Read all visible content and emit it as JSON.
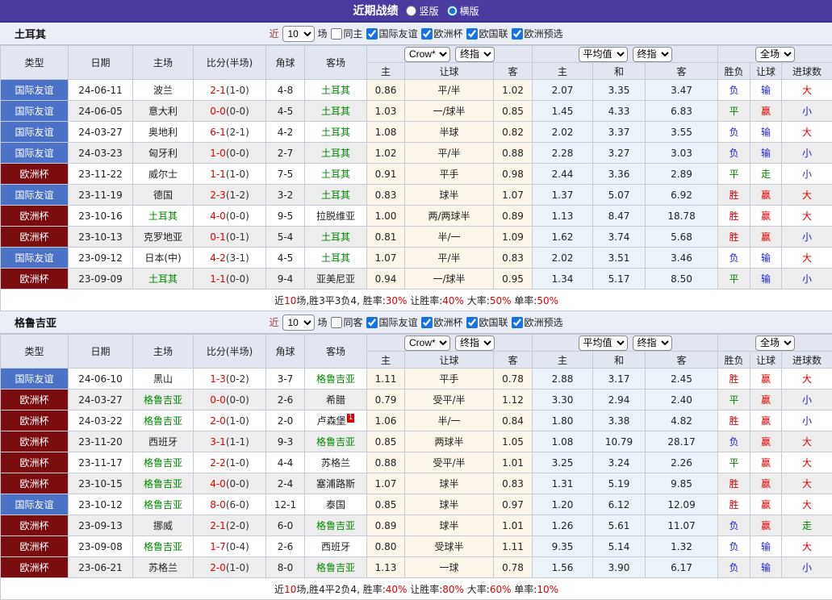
{
  "colors": {
    "header_bar": "#4b3b9e",
    "friendly_badge": "#4a73c8",
    "cup_badge": "#7b0c10",
    "focus_team_green": "#008800",
    "win_red": "#e10000",
    "loss_blue": "#2222cc",
    "draw_green": "#008000",
    "odds_col_bg": "#fcf5ea",
    "avg_col_bg": "#eaf3fa"
  },
  "titlebar": {
    "title": "近期战绩",
    "view_options": [
      {
        "label": "竖版",
        "selected": false
      },
      {
        "label": "横版",
        "selected": true
      }
    ]
  },
  "filter": {
    "near_label": "近",
    "games_value": "10",
    "games_suffix": "场",
    "leagues": [
      {
        "label": "国际友谊",
        "checked": true
      },
      {
        "label": "欧洲杯",
        "checked": true
      },
      {
        "label": "欧国联",
        "checked": true
      },
      {
        "label": "欧洲预选",
        "checked": true
      }
    ]
  },
  "table_header": {
    "main_cols": [
      "类型",
      "日期",
      "主场",
      "比分(半场)",
      "角球",
      "客场"
    ],
    "sub_cols": [
      "主",
      "让球",
      "客",
      "主",
      "和",
      "客",
      "胜负",
      "让球",
      "进球数"
    ],
    "selects": {
      "bookmaker": "Crow*",
      "period1": "终指",
      "average": "平均值",
      "period2": "终指",
      "scope": "全场"
    }
  },
  "sections": [
    {
      "team": "土耳其",
      "same_venue_label": "同主",
      "same_venue_checked": false,
      "rows": [
        {
          "type": "国际友谊",
          "badge": "friendly",
          "date": "24-06-11",
          "home": "波兰",
          "home_focus": false,
          "score": "2-1",
          "half": "(1-0)",
          "corner": "4-8",
          "away": "土耳其",
          "away_focus": true,
          "h_odds": "0.86",
          "line": "平/半",
          "a_odds": "1.02",
          "avg_h": "2.07",
          "avg_d": "3.35",
          "avg_a": "3.47",
          "res": "负",
          "res_line": "输",
          "res_goal": "大"
        },
        {
          "type": "国际友谊",
          "badge": "friendly",
          "date": "24-06-05",
          "home": "意大利",
          "home_focus": false,
          "score": "0-0",
          "half": "(0-0)",
          "corner": "4-5",
          "away": "土耳其",
          "away_focus": true,
          "h_odds": "1.03",
          "line": "一/球半",
          "a_odds": "0.85",
          "avg_h": "1.45",
          "avg_d": "4.33",
          "avg_a": "6.83",
          "res": "平",
          "res_line": "赢",
          "res_goal": "小"
        },
        {
          "type": "国际友谊",
          "badge": "friendly",
          "date": "24-03-27",
          "home": "奥地利",
          "home_focus": false,
          "score": "6-1",
          "half": "(2-1)",
          "corner": "4-2",
          "away": "土耳其",
          "away_focus": true,
          "h_odds": "1.08",
          "line": "半球",
          "a_odds": "0.82",
          "avg_h": "2.02",
          "avg_d": "3.37",
          "avg_a": "3.55",
          "res": "负",
          "res_line": "输",
          "res_goal": "大"
        },
        {
          "type": "国际友谊",
          "badge": "friendly",
          "date": "24-03-23",
          "home": "匈牙利",
          "home_focus": false,
          "score": "1-0",
          "half": "(0-0)",
          "corner": "2-7",
          "away": "土耳其",
          "away_focus": true,
          "h_odds": "1.02",
          "line": "平/半",
          "a_odds": "0.88",
          "avg_h": "2.28",
          "avg_d": "3.27",
          "avg_a": "3.03",
          "res": "负",
          "res_line": "输",
          "res_goal": "小"
        },
        {
          "type": "欧洲杯",
          "badge": "cup",
          "date": "23-11-22",
          "home": "威尔士",
          "home_focus": false,
          "score": "1-1",
          "half": "(1-0)",
          "corner": "7-5",
          "away": "土耳其",
          "away_focus": true,
          "h_odds": "0.91",
          "line": "平手",
          "a_odds": "0.98",
          "avg_h": "2.44",
          "avg_d": "3.36",
          "avg_a": "2.89",
          "res": "平",
          "res_line": "走",
          "res_goal": "小"
        },
        {
          "type": "国际友谊",
          "badge": "friendly",
          "date": "23-11-19",
          "home": "德国",
          "home_focus": false,
          "score": "2-3",
          "half": "(1-2)",
          "corner": "3-2",
          "away": "土耳其",
          "away_focus": true,
          "h_odds": "0.83",
          "line": "球半",
          "a_odds": "1.07",
          "avg_h": "1.37",
          "avg_d": "5.07",
          "avg_a": "6.92",
          "res": "胜",
          "res_line": "赢",
          "res_goal": "大"
        },
        {
          "type": "欧洲杯",
          "badge": "cup",
          "date": "23-10-16",
          "home": "土耳其",
          "home_focus": true,
          "score": "4-0",
          "half": "(0-0)",
          "corner": "9-5",
          "away": "拉脱维亚",
          "away_focus": false,
          "h_odds": "1.00",
          "line": "两/两球半",
          "a_odds": "0.89",
          "avg_h": "1.13",
          "avg_d": "8.47",
          "avg_a": "18.78",
          "res": "胜",
          "res_line": "赢",
          "res_goal": "大"
        },
        {
          "type": "欧洲杯",
          "badge": "cup",
          "date": "23-10-13",
          "home": "克罗地亚",
          "home_focus": false,
          "score": "0-1",
          "half": "(0-1)",
          "corner": "5-4",
          "away": "土耳其",
          "away_focus": true,
          "h_odds": "0.81",
          "line": "半/一",
          "a_odds": "1.09",
          "avg_h": "1.62",
          "avg_d": "3.74",
          "avg_a": "5.68",
          "res": "胜",
          "res_line": "赢",
          "res_goal": "小"
        },
        {
          "type": "国际友谊",
          "badge": "friendly",
          "date": "23-09-12",
          "home": "日本(中)",
          "home_focus": false,
          "score": "4-2",
          "half": "(3-1)",
          "corner": "4-5",
          "away": "土耳其",
          "away_focus": true,
          "h_odds": "1.07",
          "line": "平/半",
          "a_odds": "0.83",
          "avg_h": "2.02",
          "avg_d": "3.51",
          "avg_a": "3.46",
          "res": "负",
          "res_line": "输",
          "res_goal": "大"
        },
        {
          "type": "欧洲杯",
          "badge": "cup",
          "date": "23-09-09",
          "home": "土耳其",
          "home_focus": true,
          "score": "1-1",
          "half": "(0-0)",
          "corner": "9-4",
          "away": "亚美尼亚",
          "away_focus": false,
          "h_odds": "0.94",
          "line": "一/球半",
          "a_odds": "0.95",
          "avg_h": "1.34",
          "avg_d": "5.17",
          "avg_a": "8.50",
          "res": "平",
          "res_line": "输",
          "res_goal": "小"
        }
      ],
      "summary_parts": [
        {
          "text": "近",
          "red": false
        },
        {
          "text": "10",
          "red": true
        },
        {
          "text": "场,胜3平3负4, 胜率:",
          "red": false
        },
        {
          "text": "30%",
          "red": true
        },
        {
          "text": " 让胜率:",
          "red": false
        },
        {
          "text": "40%",
          "red": true
        },
        {
          "text": " 大率:",
          "red": false
        },
        {
          "text": "50%",
          "red": true
        },
        {
          "text": " 单率:",
          "red": false
        },
        {
          "text": "50%",
          "red": true
        }
      ]
    },
    {
      "team": "格鲁吉亚",
      "same_venue_label": "同客",
      "same_venue_checked": false,
      "rows": [
        {
          "type": "国际友谊",
          "badge": "friendly",
          "date": "24-06-10",
          "home": "黑山",
          "home_focus": false,
          "score": "1-3",
          "half": "(0-2)",
          "corner": "3-7",
          "away": "格鲁吉亚",
          "away_focus": true,
          "h_odds": "1.11",
          "line": "平手",
          "a_odds": "0.78",
          "avg_h": "2.88",
          "avg_d": "3.17",
          "avg_a": "2.45",
          "res": "胜",
          "res_line": "赢",
          "res_goal": "大"
        },
        {
          "type": "欧洲杯",
          "badge": "cup",
          "date": "24-03-27",
          "home": "格鲁吉亚",
          "home_focus": true,
          "score": "0-0",
          "half": "(0-0)",
          "corner": "2-6",
          "away": "希腊",
          "away_focus": false,
          "h_odds": "0.79",
          "line": "受平/半",
          "a_odds": "1.12",
          "avg_h": "3.30",
          "avg_d": "2.94",
          "avg_a": "2.40",
          "res": "平",
          "res_line": "赢",
          "res_goal": "小"
        },
        {
          "type": "欧洲杯",
          "badge": "cup",
          "date": "24-03-22",
          "home": "格鲁吉亚",
          "home_focus": true,
          "score": "2-0",
          "half": "(1-0)",
          "corner": "2-0",
          "away": "卢森堡",
          "away_focus": false,
          "away_card": "1",
          "h_odds": "1.06",
          "line": "半/一",
          "a_odds": "0.84",
          "avg_h": "1.80",
          "avg_d": "3.38",
          "avg_a": "4.82",
          "res": "胜",
          "res_line": "赢",
          "res_goal": "小"
        },
        {
          "type": "欧洲杯",
          "badge": "cup",
          "date": "23-11-20",
          "home": "西班牙",
          "home_focus": false,
          "score": "3-1",
          "half": "(1-1)",
          "corner": "9-3",
          "away": "格鲁吉亚",
          "away_focus": true,
          "h_odds": "0.85",
          "line": "两球半",
          "a_odds": "1.05",
          "avg_h": "1.08",
          "avg_d": "10.79",
          "avg_a": "28.17",
          "res": "负",
          "res_line": "赢",
          "res_goal": "大"
        },
        {
          "type": "欧洲杯",
          "badge": "cup",
          "date": "23-11-17",
          "home": "格鲁吉亚",
          "home_focus": true,
          "score": "2-2",
          "half": "(1-0)",
          "corner": "4-4",
          "away": "苏格兰",
          "away_focus": false,
          "h_odds": "0.88",
          "line": "受平/半",
          "a_odds": "1.01",
          "avg_h": "3.25",
          "avg_d": "3.24",
          "avg_a": "2.26",
          "res": "平",
          "res_line": "赢",
          "res_goal": "大"
        },
        {
          "type": "欧洲杯",
          "badge": "cup",
          "date": "23-10-15",
          "home": "格鲁吉亚",
          "home_focus": true,
          "score": "4-0",
          "half": "(0-0)",
          "corner": "2-4",
          "away": "塞浦路斯",
          "away_focus": false,
          "h_odds": "1.07",
          "line": "球半",
          "a_odds": "0.83",
          "avg_h": "1.31",
          "avg_d": "5.19",
          "avg_a": "9.85",
          "res": "胜",
          "res_line": "赢",
          "res_goal": "大"
        },
        {
          "type": "国际友谊",
          "badge": "friendly",
          "date": "23-10-12",
          "home": "格鲁吉亚",
          "home_focus": true,
          "score": "8-0",
          "half": "(6-0)",
          "corner": "12-1",
          "away": "泰国",
          "away_focus": false,
          "h_odds": "0.85",
          "line": "球半",
          "a_odds": "0.97",
          "avg_h": "1.20",
          "avg_d": "6.12",
          "avg_a": "12.09",
          "res": "胜",
          "res_line": "赢",
          "res_goal": "大"
        },
        {
          "type": "欧洲杯",
          "badge": "cup",
          "date": "23-09-13",
          "home": "挪威",
          "home_focus": false,
          "score": "2-1",
          "half": "(2-0)",
          "corner": "6-0",
          "away": "格鲁吉亚",
          "away_focus": true,
          "h_odds": "0.89",
          "line": "球半",
          "a_odds": "1.01",
          "avg_h": "1.26",
          "avg_d": "5.61",
          "avg_a": "11.07",
          "res": "负",
          "res_line": "赢",
          "res_goal": "走"
        },
        {
          "type": "欧洲杯",
          "badge": "cup",
          "date": "23-09-08",
          "home": "格鲁吉亚",
          "home_focus": true,
          "score": "1-7",
          "half": "(0-4)",
          "corner": "2-6",
          "away": "西班牙",
          "away_focus": false,
          "h_odds": "0.80",
          "line": "受球半",
          "a_odds": "1.11",
          "avg_h": "9.35",
          "avg_d": "5.14",
          "avg_a": "1.32",
          "res": "负",
          "res_line": "输",
          "res_goal": "大"
        },
        {
          "type": "欧洲杯",
          "badge": "cup",
          "date": "23-06-21",
          "home": "苏格兰",
          "home_focus": false,
          "score": "2-0",
          "half": "(1-0)",
          "corner": "8-0",
          "away": "格鲁吉亚",
          "away_focus": true,
          "h_odds": "1.13",
          "line": "一球",
          "a_odds": "0.78",
          "avg_h": "1.56",
          "avg_d": "3.90",
          "avg_a": "6.17",
          "res": "负",
          "res_line": "输",
          "res_goal": "小"
        }
      ],
      "summary_parts": [
        {
          "text": "近",
          "red": false
        },
        {
          "text": "10",
          "red": true
        },
        {
          "text": "场,胜4平2负4, 胜率:",
          "red": false
        },
        {
          "text": "40%",
          "red": true
        },
        {
          "text": " 让胜率:",
          "red": false
        },
        {
          "text": "80%",
          "red": true
        },
        {
          "text": " 大率:",
          "red": false
        },
        {
          "text": "60%",
          "red": true
        },
        {
          "text": " 单率:",
          "red": false
        },
        {
          "text": "10%",
          "red": true
        }
      ]
    }
  ]
}
